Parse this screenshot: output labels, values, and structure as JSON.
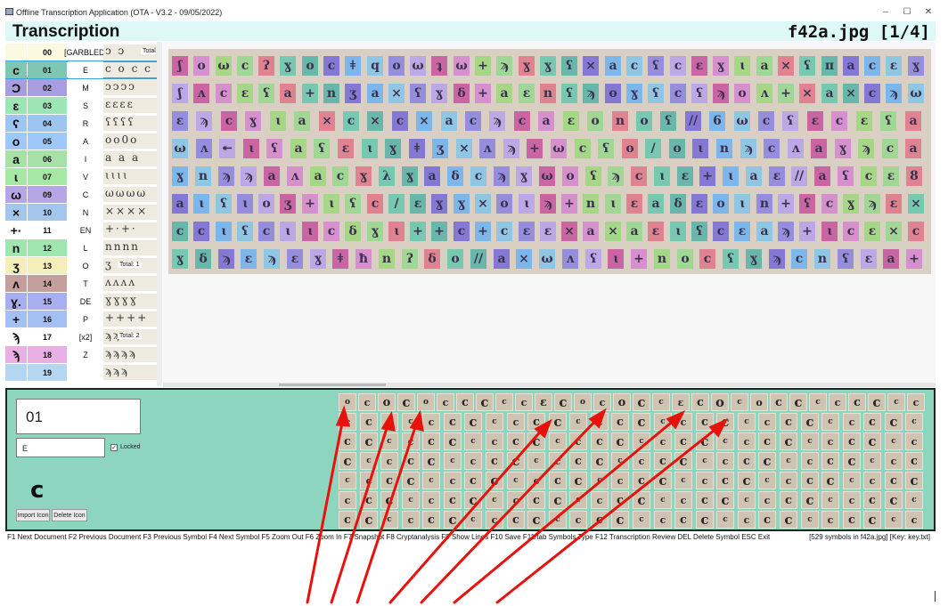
{
  "window": {
    "title": "Offline Transcription Application (OTA - V3.2 - 09/05/2022)",
    "min_glyph": "–",
    "max_glyph": "☐",
    "close_glyph": "✕"
  },
  "header": {
    "title": "Transcription",
    "document": "f42a.jpg [1/4]"
  },
  "symbols": [
    {
      "glyph": "",
      "number": "00",
      "latin": "[GARBLED]",
      "thumbs": "ↄ ↄ ",
      "total": "Total",
      "color": "#fbfae0",
      "num_color": "#fbfae0"
    },
    {
      "glyph": "c",
      "number": "01",
      "latin": "E",
      "thumbs": "c o c c",
      "color": "#7ec8b2",
      "num_color": "#7ec8b2"
    },
    {
      "glyph": "Ɔ",
      "number": "02",
      "latin": "M",
      "thumbs": "ↄↄↄↄ",
      "color": "#a79ee0",
      "num_color": "#a79ee0"
    },
    {
      "glyph": "ɛ",
      "number": "03",
      "latin": "S",
      "thumbs": "ɛɛɛɛ",
      "color": "#9ce5b5",
      "num_color": "#9ce5b5"
    },
    {
      "glyph": "ʕ",
      "number": "04",
      "latin": "R",
      "thumbs": "ʕʕʕʕ",
      "color": "#9cc5f2",
      "num_color": "#9cc5f2"
    },
    {
      "glyph": "o",
      "number": "05",
      "latin": "A",
      "thumbs": "oo0o",
      "color": "#9ec8f7",
      "num_color": "#9ec8f7"
    },
    {
      "glyph": "a",
      "number": "06",
      "latin": "I",
      "thumbs": "a a a",
      "color": "#a6e2a8",
      "num_color": "#a6e2a8"
    },
    {
      "glyph": "ɩ",
      "number": "07",
      "latin": "V",
      "thumbs": "ɩɩɩɩ",
      "color": "#a5e8a4",
      "num_color": "#a5e8a4"
    },
    {
      "glyph": "ω",
      "number": "09",
      "latin": "C",
      "thumbs": "ωωωω",
      "color": "#b6a6e6",
      "num_color": "#b6a6e6"
    },
    {
      "glyph": "×",
      "number": "10",
      "latin": "N",
      "thumbs": "××××",
      "color": "#a5c6ec",
      "num_color": "#a5c6ec"
    },
    {
      "glyph": "+·",
      "number": "11",
      "latin": "EN",
      "thumbs": "+·+·",
      "color": "#ffffff",
      "num_color": "#ffffff"
    },
    {
      "glyph": "n",
      "number": "12",
      "latin": "L",
      "thumbs": "nnnn",
      "color": "#9ee7b1",
      "num_color": "#9ee7b1"
    },
    {
      "glyph": "ʒ",
      "number": "13",
      "latin": "O",
      "thumbs": "ʒ",
      "total": "Total: 1",
      "color": "#f6eeb8",
      "num_color": "#f6eeb8"
    },
    {
      "glyph": "ʌ",
      "number": "14",
      "latin": "T",
      "thumbs": "ʌʌʌʌ",
      "color": "#c59f9c",
      "num_color": "#c59f9c"
    },
    {
      "glyph": "ɣ.",
      "number": "15",
      "latin": "DE",
      "thumbs": "ɣɣɣɣ",
      "color": "#a7aff0",
      "num_color": "#a7aff0"
    },
    {
      "glyph": "+",
      "number": "16",
      "latin": "P",
      "thumbs": "++++",
      "color": "#a4c0f2",
      "num_color": "#a4c0f2"
    },
    {
      "glyph": "ϡ",
      "number": "17",
      "latin": "[x2]",
      "thumbs": "ϡϡ",
      "total": "Total: 2",
      "color": "#ffffff",
      "num_color": "#ffffff"
    },
    {
      "glyph": "ϡ",
      "number": "18",
      "latin": "Z",
      "thumbs": "ϡϡϡϡ",
      "color": "#e9aee3",
      "num_color": "#e9aee3"
    },
    {
      "glyph": "",
      "number": "19",
      "latin": "",
      "thumbs": "ϡϡϡ",
      "color": "#b4d6f0",
      "num_color": "#b4d6f0"
    }
  ],
  "editor": {
    "symbol_number": "01",
    "symbol_latin": "E",
    "locked_check": "✓",
    "locked_label": "Locked",
    "icon_glyph": "c",
    "import_icon": "Import Icon",
    "delete_icon": "Delete Icon"
  },
  "status": {
    "keys": "F1 Next Document F2 Previous Document F3 Previous Symbol F4 Next Symbol F5 Zoom Out F6 Zoom In F7 Snapshot F8 Cryptanalysis F9 Show Lines F10 Save F11/tab Symbols Type F12 Transcription Review DEL Delete Symbol ESC Exit",
    "info": "[529 symbols in f42a.jpg] [Key: key.txt]"
  },
  "colors": {
    "header_bg": "#def8f8",
    "editor_bg": "#8dd5bf",
    "arrow": "#e8120c",
    "selected_outline": "#3aa3e0"
  },
  "manuscript_lines": [
    "ʃ o ω c ʔ ɣ o c ǂ q o ω ʇ ω + ϡ ɣ ɣ ʕ × a c ʕ c ɛ ɣ ɩ a × ʕ π a c ɛ ɣ",
    "ʃ ʌ c ɛ ʕ a + n ʒ a × ʕ ɣ δ + a ɛ n ʕ ϡ o ɣ ʕ c ʕ ϡ o ʌ + × a × c ϡ ω",
    "ɛ ϡ c ɣ ɩ a × c × c × a c ϡ c a ɛ o n o ʕ // 6 ω c ʕ ɛ c ɛ ʕ a",
    "ω ʌ ↞ ɩ ʕ a ʕ ɛ ɩ ɣ ǂ ʒ × ʌ ϡ + ω c ʕ o / o ɩ n ϡ c ʌ a ɣ ϡ c a",
    "ɣ n ϡ ϡ a ʌ a c ɣ λ ɣ a δ c ϡ ɣ ω o ʕ ϡ c ɩ ɛ + ɩ a ɛ // a ʕ c ɛ 8",
    "a ɩ ʕ ɩ o ʒ + ɩ ʕ c / ɛ ɣ ɣ × o ɩ ϡ + n ɩ ɛ a δ ɛ o ɩ n + ʕ c ɣ ϡ ɛ ×",
    "c c ɩ ʕ c ɩ ɩ c δ ɣ ɩ + + c + c ɛ ɛ × a × a ɛ ɩ ʕ c ɛ a ϡ + ɩ c ɛ × c",
    "ɣ δ ϡ ɛ ϡ ɛ ɣ ǂ ħ n ʔ δ o // a × ω ʌ ʕ ɩ + n o c ʕ ɣ ϡ c n ʕ ɛ a +"
  ],
  "manuscript_palette": [
    "#c85aa0",
    "#6dc8b0",
    "#8e87e0",
    "#9bd88f",
    "#73b4f0",
    "#d68ad0",
    "#5db4a8",
    "#b8a4e8",
    "#e07b8c",
    "#88c6e8",
    "#a0d880",
    "#7a70d8"
  ],
  "sample_rows": [
    "o c o c o c c c c c ɛ c o c o c c ɛ c o c o c c c c c c c c",
    "c c c c c c c c c c c c c c c c c c c c c c c c c c c c",
    "c c c c c c c c c c c c c c c c c c c c c c c c c c c c",
    "c c c c c c c c c c c c c c c c c c c c c c c c c c c c",
    "c c c c c c c c c c c c c c c c c c c c c c c c c c c c",
    "c c c c c c c c c c c c c c c c c c c c c c c c c c c c",
    "c c c c c c c c c c c c c c c c c c c c c c c c c c c c"
  ]
}
